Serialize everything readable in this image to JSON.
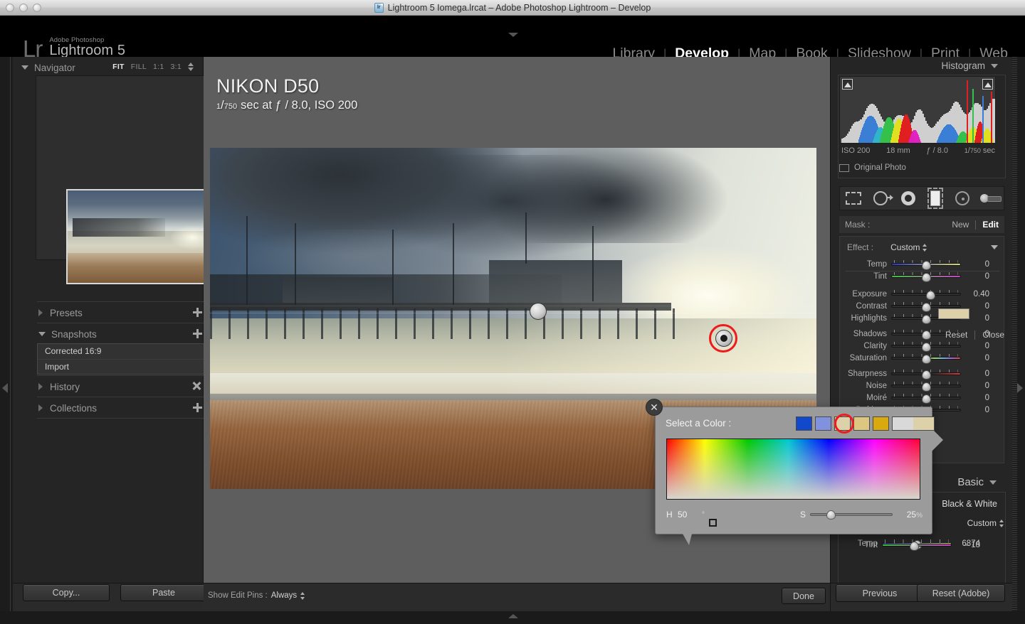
{
  "window": {
    "title": "Lightroom 5 Iomega.lrcat – Adobe Photoshop Lightroom – Develop",
    "doc_icon": "lr"
  },
  "header": {
    "logo_small": "Adobe Photoshop",
    "logo_big": "Lightroom 5",
    "logo_mark": "Lr",
    "modules": [
      {
        "label": "Library",
        "active": false
      },
      {
        "label": "Develop",
        "active": true
      },
      {
        "label": "Map",
        "active": false
      },
      {
        "label": "Book",
        "active": false
      },
      {
        "label": "Slideshow",
        "active": false
      },
      {
        "label": "Print",
        "active": false
      },
      {
        "label": "Web",
        "active": false
      }
    ]
  },
  "left_panel": {
    "navigator": {
      "title": "Navigator",
      "zoom_levels": [
        "FIT",
        "FILL",
        "1:1",
        "3:1"
      ],
      "active_zoom": "FIT"
    },
    "presets": {
      "title": "Presets"
    },
    "snapshots": {
      "title": "Snapshots",
      "items": [
        {
          "label": "Corrected 16:9"
        },
        {
          "label": "Import"
        }
      ]
    },
    "history": {
      "title": "History"
    },
    "collections": {
      "title": "Collections"
    },
    "copy_label": "Copy...",
    "paste_label": "Paste"
  },
  "center": {
    "photo_info": {
      "camera": "NIKON D50",
      "shutter_num": "1",
      "shutter_den": "750",
      "exposure_text": "sec at ƒ / 8.0, ISO 200"
    },
    "toolbar": {
      "show_edit_pins_label": "Show Edit Pins :",
      "show_edit_pins_value": "Always",
      "done_label": "Done"
    }
  },
  "right_panel": {
    "histogram": {
      "title": "Histogram",
      "iso": "ISO 200",
      "focal": "18 mm",
      "aperture": "ƒ / 8.0",
      "shutter_num": "1",
      "shutter_den": "750",
      "shutter_unit": "sec",
      "original_photo_label": "Original Photo"
    },
    "tools": [
      {
        "name": "crop-overlay-tool",
        "selected": false
      },
      {
        "name": "spot-removal-tool",
        "selected": false
      },
      {
        "name": "red-eye-correction-tool",
        "selected": false
      },
      {
        "name": "graduated-filter-tool",
        "selected": true
      },
      {
        "name": "radial-filter-tool",
        "selected": false
      },
      {
        "name": "adjustment-brush-tool",
        "selected": false
      }
    ],
    "mask": {
      "label": "Mask :",
      "new_label": "New",
      "edit_label": "Edit"
    },
    "effect": {
      "label": "Effect :",
      "value": "Custom"
    },
    "sliders": [
      {
        "label": "Temp",
        "value": "0",
        "pos": 50,
        "bar": "temp"
      },
      {
        "label": "Tint",
        "value": "0",
        "pos": 50,
        "bar": "tint"
      },
      {
        "label": "Exposure",
        "value": "0.40",
        "pos": 57,
        "bar": "plain"
      },
      {
        "label": "Contrast",
        "value": "0",
        "pos": 50,
        "bar": "plain"
      },
      {
        "label": "Highlights",
        "value": "0",
        "pos": 50,
        "bar": "plain"
      },
      {
        "label": "Shadows",
        "value": "0",
        "pos": 50,
        "bar": "plain"
      },
      {
        "label": "Clarity",
        "value": "0",
        "pos": 50,
        "bar": "plain"
      },
      {
        "label": "Saturation",
        "value": "0",
        "pos": 50,
        "bar": "sat"
      },
      {
        "label": "Sharpness",
        "value": "0",
        "pos": 50,
        "bar": "sharp"
      },
      {
        "label": "Noise",
        "value": "0",
        "pos": 50,
        "bar": "plain"
      },
      {
        "label": "Moiré",
        "value": "0",
        "pos": 50,
        "bar": "plain"
      },
      {
        "label": "Defringe",
        "value": "0",
        "pos": 50,
        "bar": "plain"
      }
    ],
    "panel_color_swatch": "#ddd1aa",
    "reset_label": "Reset",
    "close_label": "Close",
    "basic": {
      "title": "Basic",
      "black_and_white_label": "Black & White",
      "wb_value": "Custom",
      "temp_label": "Temp",
      "temp_value": "6874",
      "tint_label": "Tint",
      "tint_value": "– 18"
    },
    "previous_label": "Previous",
    "reset_adobe_label": "Reset (Adobe)"
  },
  "color_picker": {
    "title": "Select a Color :",
    "close_glyph": "✕",
    "swatches": [
      "#1148cc",
      "#8091dd",
      "#ddd1aa",
      "#ddc682",
      "#d9a90d"
    ],
    "selected_swatch_index": 2,
    "current_color": "#ddd1aa",
    "hue_label": "H",
    "hue_value": "50",
    "hue_unit": "°",
    "sat_label": "S",
    "sat_value": "25",
    "sat_unit": "%"
  },
  "accent_colors": {
    "highlight_ring": "#ee1b1b",
    "panel_bg": "#252525",
    "canvas_bg": "#5e5e5e"
  }
}
